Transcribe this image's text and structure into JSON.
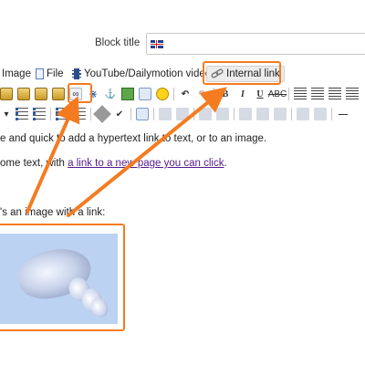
{
  "block_title": {
    "label": "Block title",
    "value": ""
  },
  "insert_toolbar": {
    "items": [
      {
        "label": "Image",
        "icon": "image-icon"
      },
      {
        "label": "File",
        "icon": "file-icon"
      },
      {
        "label": "YouTube/Dailymotion video",
        "icon": "film-icon"
      },
      {
        "label": "Internal link",
        "icon": "chain-link-icon"
      }
    ]
  },
  "editor_toolbar": {
    "row1": [
      "paste-icon",
      "paste-text-icon",
      "paste-word-icon",
      "link-icon",
      "unlink-icon",
      "anchor-icon",
      "insert-image-icon",
      "insert-flash-icon",
      "smiley-icon",
      "undo-icon",
      "redo-icon",
      "bold",
      "italic",
      "underline",
      "strikethrough",
      "align-left",
      "align-center",
      "align-right",
      "justify"
    ],
    "bold_label": "B",
    "italic_label": "I",
    "underline_label": "U",
    "strike_label": "ABC"
  },
  "content": {
    "line1": "e and quick to add a hypertext link to text, or to an image.",
    "line2_prefix": "ome text, with ",
    "line2_link": "a link to a new page you can click",
    "line2_suffix": ".",
    "line3": "'s an image with a link:"
  },
  "colors": {
    "highlight": "#f47b20",
    "visited_link": "#551a8b"
  }
}
